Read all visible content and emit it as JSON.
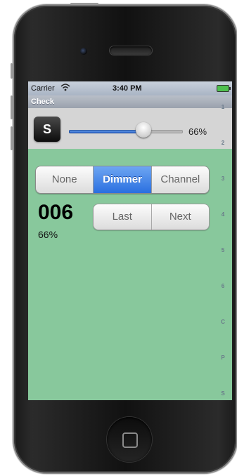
{
  "status": {
    "carrier": "Carrier",
    "time": "3:40 PM"
  },
  "header": {
    "title": "Check"
  },
  "top_controls": {
    "button_label": "S",
    "slider_value_percent": 66,
    "slider_label": "66%"
  },
  "mode_selector": {
    "options": [
      "None",
      "Dimmer",
      "Channel"
    ],
    "selected": "Dimmer"
  },
  "channel": {
    "number": "006",
    "level": "66%"
  },
  "navigation": {
    "last_label": "Last",
    "next_label": "Next"
  },
  "index_bar": {
    "items": [
      "1",
      "2",
      "3",
      "4",
      "5",
      "6",
      "C",
      "P",
      "S"
    ]
  },
  "colors": {
    "screen_background": "#88c89c",
    "selected_segment": "#2a6fe0"
  }
}
